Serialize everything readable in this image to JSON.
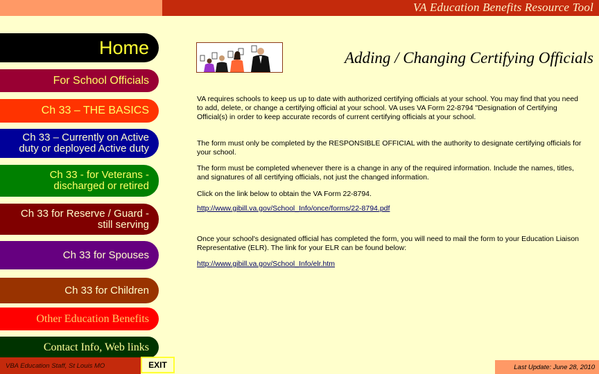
{
  "header": {
    "app_title": "VA Education Benefits Resource Tool"
  },
  "page": {
    "title": "Adding / Changing Certifying Officials",
    "clipart": "people-holding-voting-cards-image"
  },
  "nav": {
    "items": [
      {
        "label_lines": [
          "Home"
        ],
        "bg": "#000000",
        "fg": "#FFFF33"
      },
      {
        "label_lines": [
          "For School Officials"
        ],
        "bg": "#990033",
        "fg": "#FFFF66"
      },
      {
        "label_lines": [
          "Ch 33 – THE BASICS"
        ],
        "bg": "#FF3300",
        "fg": "#FFFF66"
      },
      {
        "label_lines": [
          "Ch 33 – Currently on Active",
          "duty or deployed Active duty"
        ],
        "bg": "#000099",
        "fg": "#FFFFCC"
      },
      {
        "label_lines": [
          "Ch 33 - for Veterans -",
          "discharged or retired"
        ],
        "bg": "#008000",
        "fg": "#FFFF66"
      },
      {
        "label_lines": [
          "Ch 33 for Reserve / Guard -",
          "still serving"
        ],
        "bg": "#800000",
        "fg": "#FFFFCC"
      },
      {
        "label_lines": [
          "Ch 33 for Spouses"
        ],
        "bg": "#660080",
        "fg": "#FFFFCC"
      },
      {
        "label_lines": [
          "Ch 33 for Children"
        ],
        "bg": "#993300",
        "fg": "#FFFFCC"
      },
      {
        "label_lines": [
          "Other Education Benefits"
        ],
        "bg": "#FF0000",
        "fg": "#FFCC66"
      },
      {
        "label_lines": [
          "Contact Info, Web links"
        ],
        "bg": "#003300",
        "fg": "#FFFF99"
      }
    ]
  },
  "content": {
    "para1": "VA requires schools to keep us up to date with authorized certifying officials at your school.  You may find that you need to add, delete, or change a certifying official at your school.  VA uses VA Form 22-8794 \"Designation of Certifying Official(s) in order to keep accurate records of current certifying officials at your school.",
    "para2": "The form must only be completed by the RESPONSIBLE OFFICIAL with the authority to designate certifying officials for your school.",
    "para3": "The form must be completed whenever there is a change in any of the required information.  Include the names, titles, and signatures of all certifying officials, not just the changed information.",
    "para4": "Click on the link below to obtain the VA Form 22-8794.",
    "link1": "http://www.gibill.va.gov/School_Info/once/forms/22-8794.pdf",
    "para5": "Once your school's designated official has completed the form, you will need to mail the form to your Education Liaison Representative (ELR).  The link for your ELR can be found below:",
    "link2": "http://www.gibill.va.gov/School_Info/elr.htm"
  },
  "footer": {
    "staff": "VBA Education Staff, St Louis MO",
    "exit_label": "EXIT",
    "last_update": "Last Update:  June 28, 2010"
  }
}
